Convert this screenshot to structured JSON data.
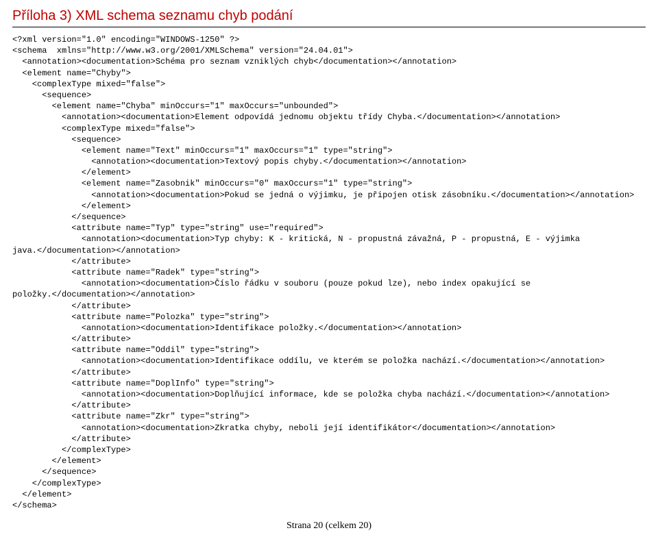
{
  "heading": "Příloha 3) XML schema seznamu chyb podání",
  "code": "<?xml version=\"1.0\" encoding=\"WINDOWS-1250\" ?>\n<schema  xmlns=\"http://www.w3.org/2001/XMLSchema\" version=\"24.04.01\">\n  <annotation><documentation>Schéma pro seznam vzniklých chyb</documentation></annotation>\n  <element name=\"Chyby\">\n    <complexType mixed=\"false\">\n      <sequence>\n        <element name=\"Chyba\" minOccurs=\"1\" maxOccurs=\"unbounded\">\n          <annotation><documentation>Element odpovídá jednomu objektu třídy Chyba.</documentation></annotation>\n          <complexType mixed=\"false\">\n            <sequence>\n              <element name=\"Text\" minOccurs=\"1\" maxOccurs=\"1\" type=\"string\">\n                <annotation><documentation>Textový popis chyby.</documentation></annotation>\n              </element>\n              <element name=\"Zasobnik\" minOccurs=\"0\" maxOccurs=\"1\" type=\"string\">\n                <annotation><documentation>Pokud se jedná o výjimku, je připojen otisk zásobníku.</documentation></annotation>\n              </element>\n            </sequence>\n            <attribute name=\"Typ\" type=\"string\" use=\"required\">\n              <annotation><documentation>Typ chyby: K - kritická, N - propustná závažná, P - propustná, E - výjimka\njava.</documentation></annotation>\n            </attribute>\n            <attribute name=\"Radek\" type=\"string\">\n              <annotation><documentation>Číslo řádku v souboru (pouze pokud lze), nebo index opakující se\npoložky.</documentation></annotation>\n            </attribute>\n            <attribute name=\"Polozka\" type=\"string\">\n              <annotation><documentation>Identifikace položky.</documentation></annotation>\n            </attribute>\n            <attribute name=\"Oddil\" type=\"string\">\n              <annotation><documentation>Identifikace oddílu, ve kterém se položka nachází.</documentation></annotation>\n            </attribute>\n            <attribute name=\"DoplInfo\" type=\"string\">\n              <annotation><documentation>Doplňující informace, kde se položka chyba nachází.</documentation></annotation>\n            </attribute>\n            <attribute name=\"Zkr\" type=\"string\">\n              <annotation><documentation>Zkratka chyby, neboli její identifikátor</documentation></annotation>\n            </attribute>\n          </complexType>\n        </element>\n      </sequence>\n    </complexType>\n  </element>\n</schema>",
  "footer": "Strana 20 (celkem 20)"
}
